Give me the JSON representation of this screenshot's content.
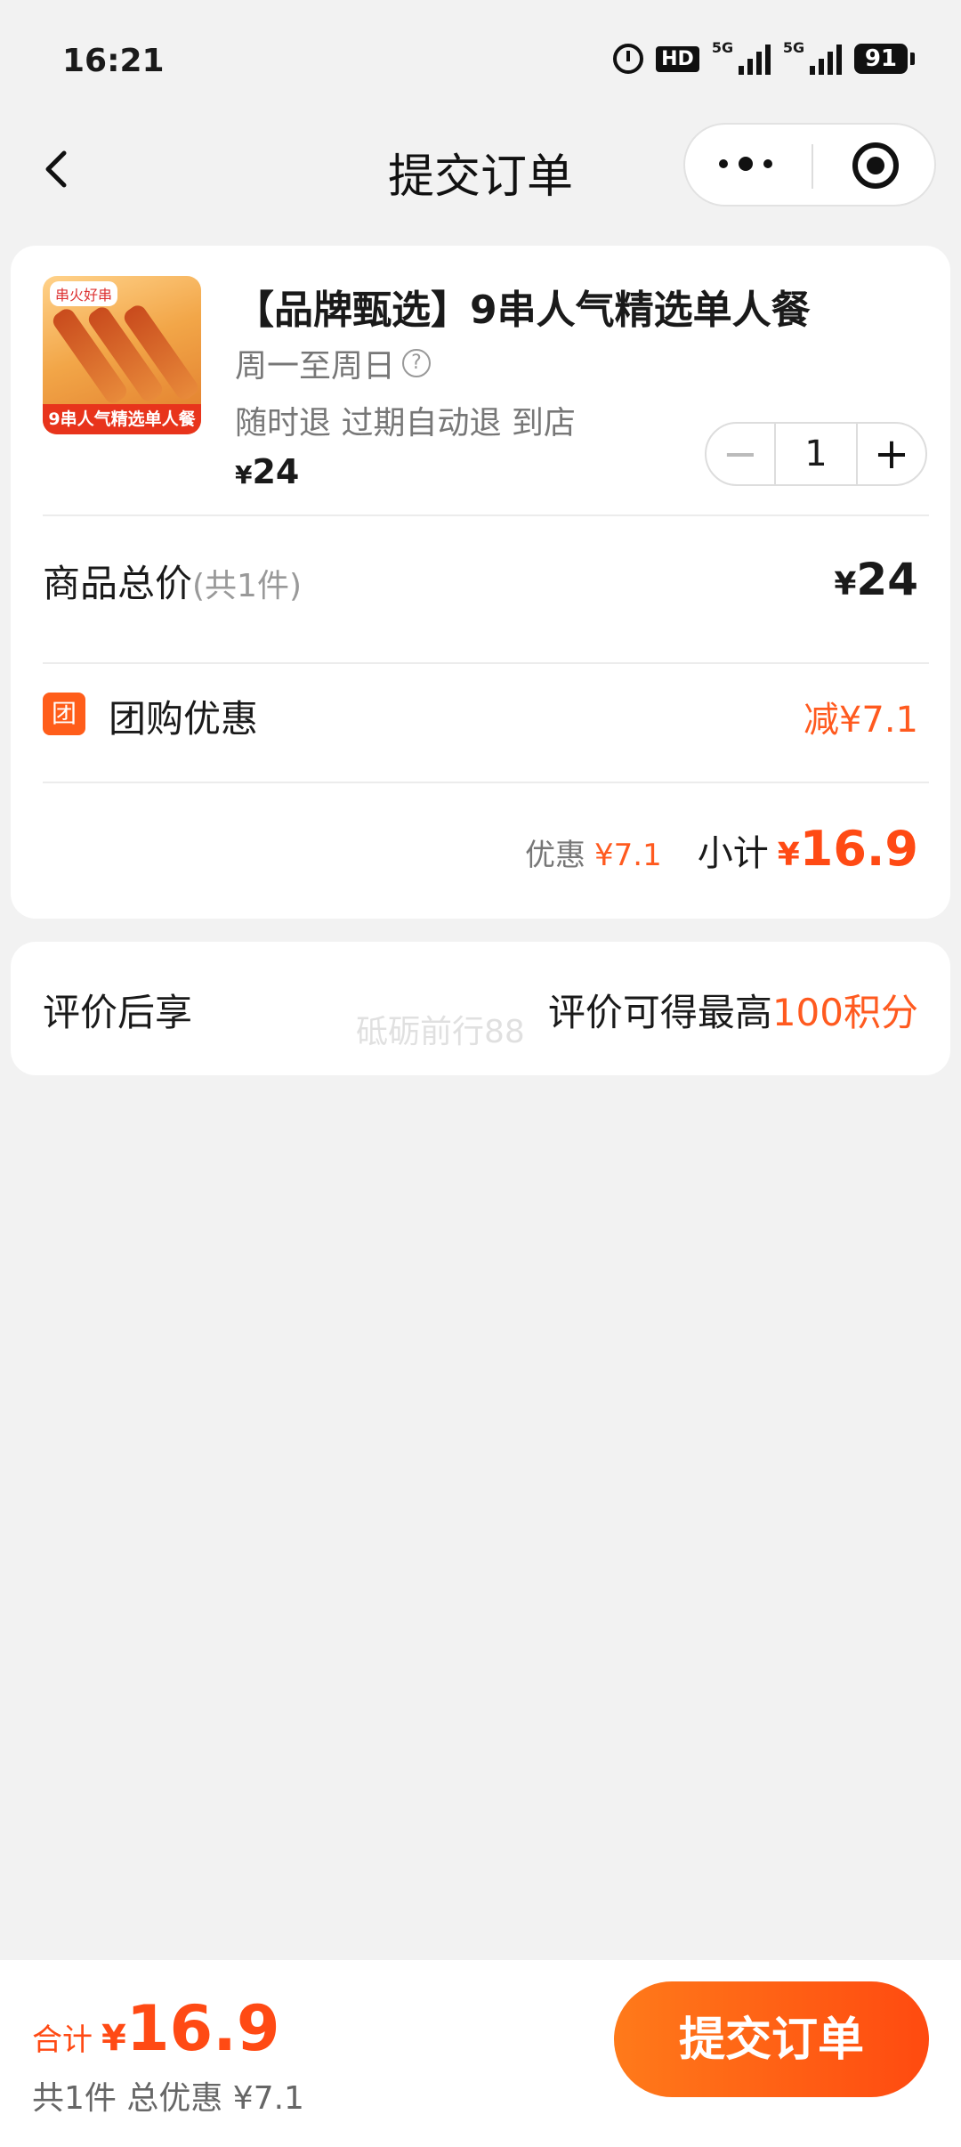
{
  "status_bar": {
    "time": "16:21",
    "hd": "HD",
    "net1": "5G",
    "net2": "5G",
    "battery": "91"
  },
  "nav": {
    "title": "提交订单"
  },
  "product": {
    "thumb_brand": "串火好串",
    "thumb_banner": "9串人气精选单人餐",
    "title": "【品牌甄选】9串人气精选单人餐",
    "days": "周一至周日",
    "policy": "随时退 过期自动退 到店",
    "price_symbol": "¥",
    "price": "24",
    "quantity": "1"
  },
  "summary": {
    "total_label": "商品总价",
    "total_count": "(共1件)",
    "total_symbol": "¥",
    "total_value": "24",
    "group_icon": "团",
    "group_label": "团购优惠",
    "group_value": "减¥7.1",
    "discount_label": "优惠",
    "discount_value": "¥7.1",
    "subtotal_label": "小计",
    "subtotal_symbol": "¥",
    "subtotal_value": "16.9"
  },
  "review": {
    "left": "评价后享",
    "right_prefix": "评价可得最高",
    "right_highlight": "100积分"
  },
  "watermark": "砥砺前行88",
  "footer": {
    "sum_label": "合计",
    "sum_symbol": "¥",
    "sum_value": "16.9",
    "sub_text": "共1件 总优惠 ¥7.1",
    "submit_label": "提交订单"
  },
  "colors": {
    "accent": "#ff4a14",
    "background": "#f2f2f2"
  }
}
